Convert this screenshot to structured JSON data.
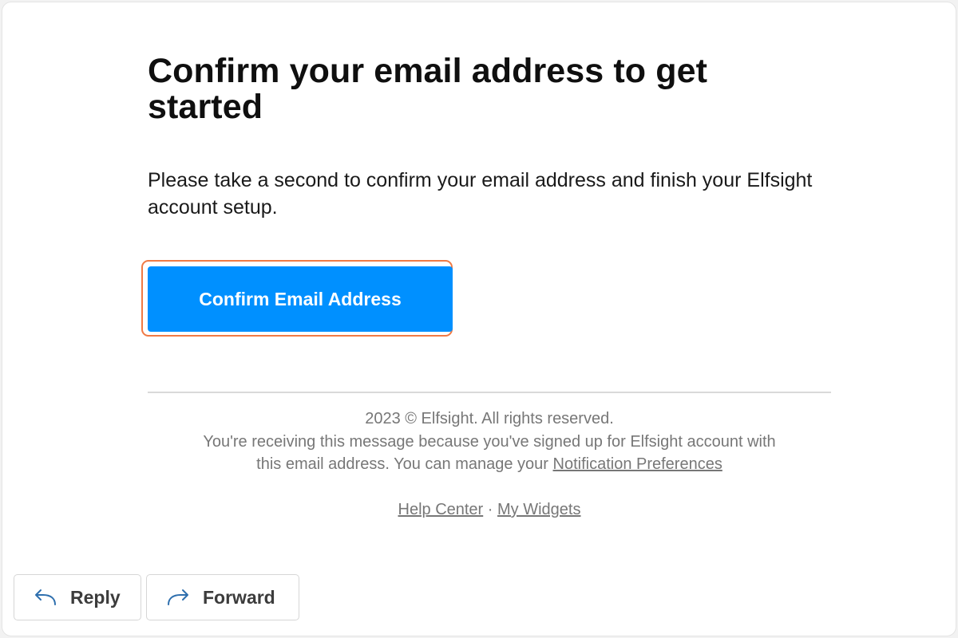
{
  "email": {
    "headline": "Confirm your email address to get started",
    "intro": "Please take a second to confirm your email address and finish your Elfsight account setup.",
    "cta_label": "Confirm Email Address",
    "footer": {
      "copyright": "2023 © Elfsight. All rights reserved.",
      "notice_line1": "You're receiving this message because you've signed up for Elfsight account with",
      "notice_line2": "this email address. You can manage your",
      "preferences_link": "Notification Preferences",
      "help_link": "Help Center",
      "separator": "·",
      "widgets_link": "My Widgets"
    }
  },
  "actions": {
    "reply_label": "Reply",
    "forward_label": "Forward"
  },
  "colors": {
    "accent": "#0090ff",
    "highlight": "#f07a45",
    "icon": "#2e6fae"
  }
}
